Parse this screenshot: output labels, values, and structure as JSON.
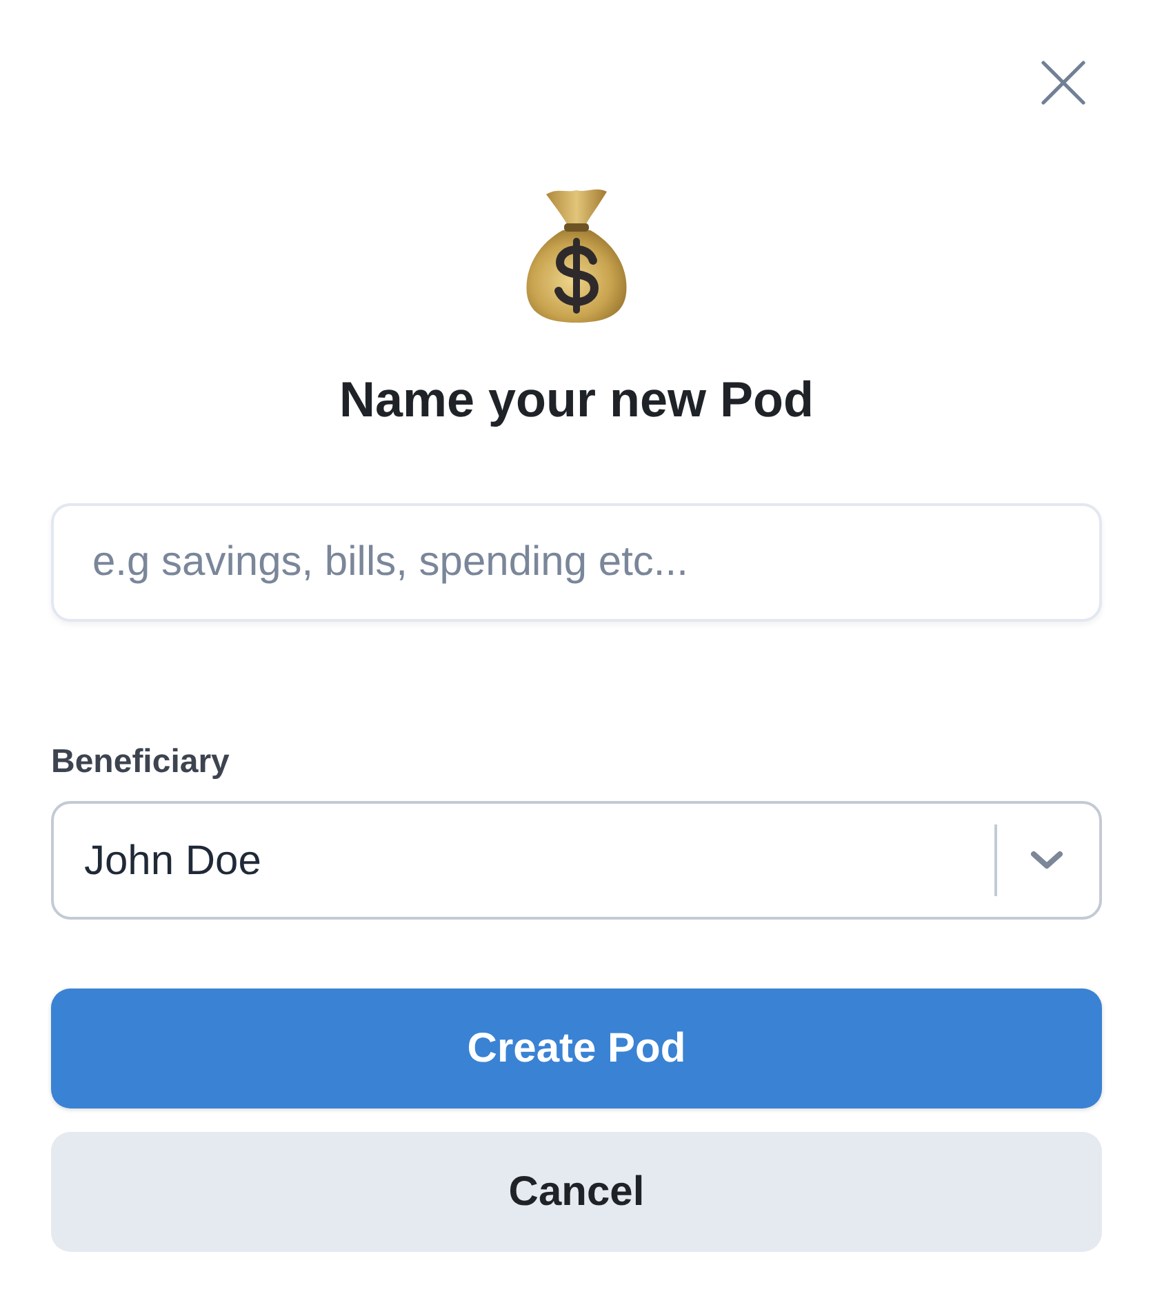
{
  "dialog": {
    "title": "Name your new Pod",
    "name_field": {
      "placeholder": "e.g savings, bills, spending etc..."
    },
    "beneficiary": {
      "label": "Beneficiary",
      "value": "John Doe"
    },
    "buttons": [
      {
        "label": "Create Pod",
        "kind": "primary"
      },
      {
        "label": "Cancel",
        "kind": "secondary"
      }
    ]
  }
}
